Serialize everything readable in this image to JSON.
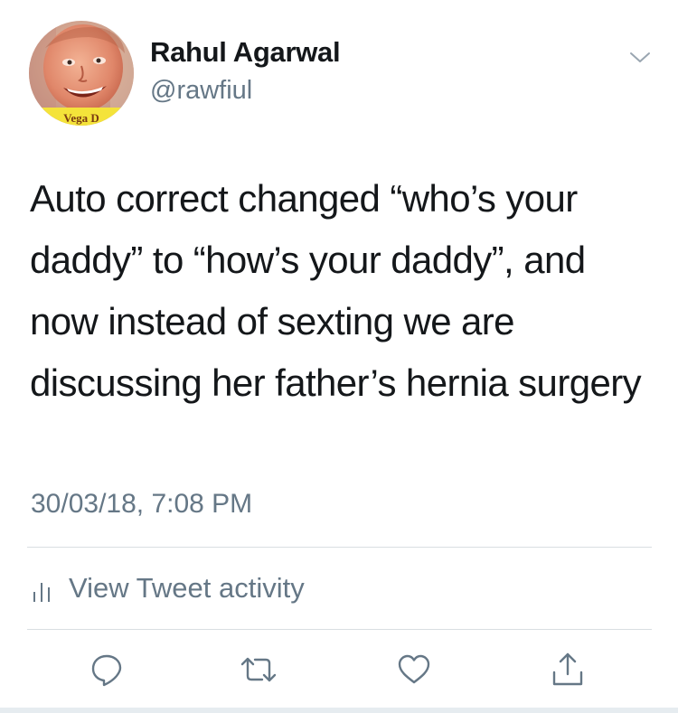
{
  "user": {
    "name": "Rahul Agarwal",
    "handle": "@rawfiul",
    "avatar_overlay_text": "Vega D"
  },
  "tweet": {
    "text": "Auto correct changed “who’s your daddy” to “how’s your daddy”, and now instead of sexting we are discussing her father’s hernia surgery",
    "timestamp": "30/03/18, 7:08 PM"
  },
  "activity": {
    "label": "View Tweet activity",
    "icon": "bar-chart-icon"
  },
  "actions": [
    {
      "name": "reply",
      "icon": "reply-icon"
    },
    {
      "name": "retweet",
      "icon": "retweet-icon"
    },
    {
      "name": "like",
      "icon": "heart-icon"
    },
    {
      "name": "share",
      "icon": "share-icon"
    }
  ],
  "menu": {
    "icon": "chevron-down-icon"
  },
  "colors": {
    "text_primary": "#14171a",
    "text_secondary": "#657786",
    "divider": "#d9dee2",
    "background": "#ffffff"
  }
}
